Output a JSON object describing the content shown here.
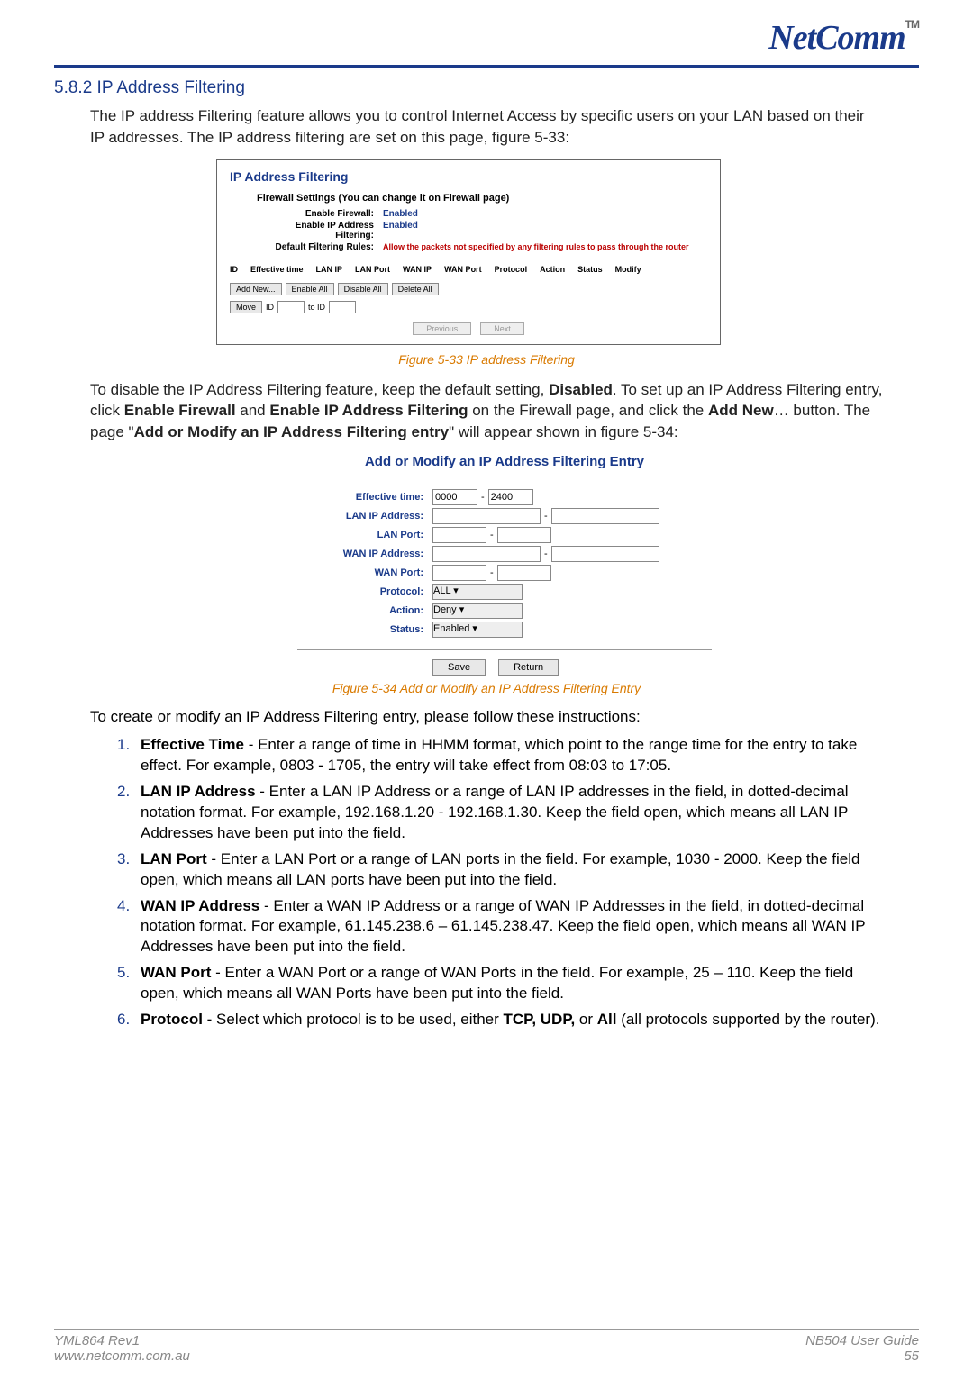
{
  "brand": "NetComm",
  "tm": "TM",
  "section_title": "5.8.2 IP Address Filtering",
  "intro": "The IP address Filtering feature allows you to control Internet Access by specific users on your LAN based on their IP addresses. The IP address filtering are set on this page, figure 5-33:",
  "fig1": {
    "title": "IP Address Filtering",
    "subtitle": "Firewall Settings (You can change it on Firewall page)",
    "rows": [
      {
        "label": "Enable Firewall:",
        "val": "Enabled",
        "cls": "fig1-val-blue"
      },
      {
        "label": "Enable IP Address Filtering:",
        "val": "Enabled",
        "cls": "fig1-val-blue"
      },
      {
        "label": "Default Filtering Rules:",
        "val": "Allow the packets not specified by any filtering rules to pass through the router",
        "cls": "fig1-val-red"
      }
    ],
    "cols": [
      "ID",
      "Effective time",
      "LAN IP",
      "LAN Port",
      "WAN IP",
      "WAN Port",
      "Protocol",
      "Action",
      "Status",
      "Modify"
    ],
    "btns": [
      "Add New...",
      "Enable All",
      "Disable All",
      "Delete All"
    ],
    "move": "Move",
    "id_label": "ID",
    "toid": "to ID",
    "prev": "Previous",
    "next": "Next"
  },
  "caption1": "Figure 5-33 IP address Filtering",
  "para2": "To disable the IP Address Filtering feature, keep the default setting, Disabled. To set up an IP Address Filtering entry, click Enable Firewall and Enable IP Address Filtering on the Firewall page, and click the Add New… button. The page \"Add or Modify an IP Address Filtering entry\" will appear shown in figure 5-34:",
  "fig2": {
    "title": "Add or Modify an IP Address Filtering Entry",
    "fields": [
      {
        "label": "Effective time:",
        "type": "range2s",
        "v1": "0000",
        "v2": "2400"
      },
      {
        "label": "LAN IP Address:",
        "type": "range2",
        "v1": "",
        "v2": ""
      },
      {
        "label": "LAN Port:",
        "type": "range2n",
        "v1": "",
        "v2": ""
      },
      {
        "label": "WAN IP Address:",
        "type": "range2",
        "v1": "",
        "v2": ""
      },
      {
        "label": "WAN Port:",
        "type": "range2n",
        "v1": "",
        "v2": ""
      },
      {
        "label": "Protocol:",
        "type": "select",
        "v1": "ALL"
      },
      {
        "label": "Action:",
        "type": "select",
        "v1": "Deny"
      },
      {
        "label": "Status:",
        "type": "select",
        "v1": "Enabled"
      }
    ],
    "save": "Save",
    "return": "Return"
  },
  "caption2": "Figure 5-34 Add or Modify an IP Address Filtering Entry",
  "instr_intro": "To create or modify an IP Address Filtering entry, please follow these instructions:",
  "instructions": [
    {
      "n": "1.",
      "b": "Effective Time",
      "t": " - Enter a range of time in HHMM format, which point to the range time for the entry to take effect. For example, 0803 - 1705, the entry will take effect from 08:03 to 17:05."
    },
    {
      "n": "2.",
      "b": "LAN IP Address",
      "t": " - Enter a LAN IP Address or a range of LAN IP addresses in the field, in dotted-decimal notation format. For example, 192.168.1.20 - 192.168.1.30. Keep the field open, which means all LAN IP Addresses have been put into the field."
    },
    {
      "n": "3.",
      "b": "LAN Port",
      "t": " - Enter a LAN Port or a range of LAN ports in the field. For example, 1030 - 2000. Keep the field open, which means all LAN ports have been put into the field."
    },
    {
      "n": "4.",
      "b": "WAN IP Address",
      "t": " - Enter a WAN IP Address or a range of WAN IP Addresses in the field, in dotted-decimal notation format. For example, 61.145.238.6 – 61.145.238.47. Keep the field open, which means all WAN IP Addresses have been put into the field."
    },
    {
      "n": "5.",
      "b": "WAN Port",
      "t": " - Enter a WAN Port or a range of WAN Ports in the field. For example, 25 – 110. Keep the field open, which means all WAN Ports have been put into the field."
    },
    {
      "n": "6.",
      "b": "Protocol",
      "t": " - Select which protocol is to be used, either TCP, UDP, or All (all protocols supported by the router)."
    }
  ],
  "footer": {
    "left1": "YML864 Rev1",
    "left2": "www.netcomm.com.au",
    "right1": "NB504 User Guide",
    "right2": "55"
  }
}
